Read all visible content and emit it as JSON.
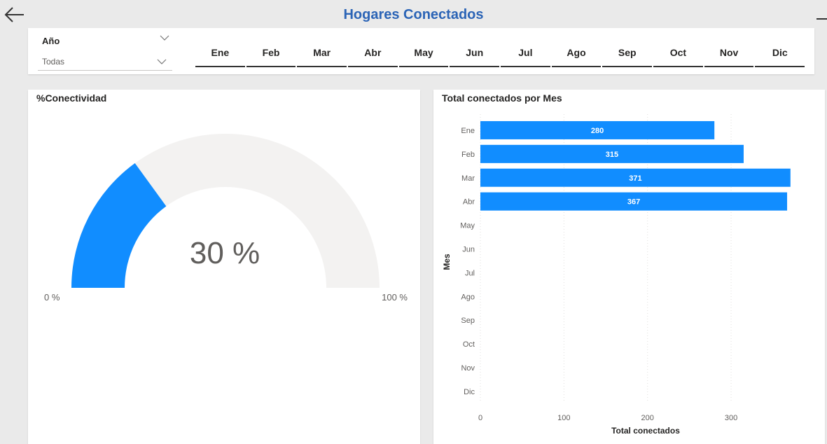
{
  "header": {
    "title": "Hogares Conectados",
    "back_icon": "arrow-left-icon",
    "forward_icon": "arrow-right-icon"
  },
  "slicer": {
    "title": "Año",
    "selected": "Todas"
  },
  "months": [
    "Ene",
    "Feb",
    "Mar",
    "Abr",
    "May",
    "Jun",
    "Jul",
    "Ago",
    "Sep",
    "Oct",
    "Nov",
    "Dic"
  ],
  "gauge": {
    "title": "%Conectividad",
    "value_label": "30 %",
    "value_fraction": 0.3,
    "min_label": "0 %",
    "max_label": "100 %",
    "fill_color": "#118dff",
    "track_color": "#f3f2f1"
  },
  "bar_chart": {
    "title": "Total conectados por Mes",
    "bar_color": "#118dff"
  },
  "chart_data": {
    "type": "bar",
    "orientation": "horizontal",
    "categories": [
      "Ene",
      "Feb",
      "Mar",
      "Abr",
      "May",
      "Jun",
      "Jul",
      "Ago",
      "Sep",
      "Oct",
      "Nov",
      "Dic"
    ],
    "values": [
      280,
      315,
      371,
      367,
      null,
      null,
      null,
      null,
      null,
      null,
      null,
      null
    ],
    "data_labels": [
      "280",
      "315",
      "371",
      "367"
    ],
    "xlabel": "Total conectados",
    "ylabel": "Mes",
    "xticks": [
      "0",
      "100",
      "200",
      "300"
    ],
    "xlim": [
      0,
      372
    ],
    "grid": true
  }
}
